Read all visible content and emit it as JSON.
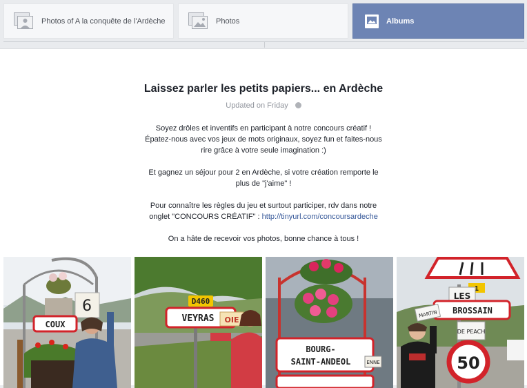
{
  "tabs": [
    {
      "label": "Photos of A la conquête de l'Ardèche",
      "icon": "photos-of-icon",
      "active": false
    },
    {
      "label": "Photos",
      "icon": "photos-icon",
      "active": false
    },
    {
      "label": "Albums",
      "icon": "albums-icon",
      "active": true
    }
  ],
  "album": {
    "title": "Laissez parler les petits papiers... en Ardèche",
    "updated": "Updated on Friday",
    "updated_icon": "globe-icon",
    "description": {
      "p1_line1": "Soyez drôles et inventifs en participant à notre concours créatif !",
      "p1_line2": "Épatez-nous avec vos jeux de mots originaux, soyez fun et faites-nous",
      "p1_line3": "rire grâce à votre seule imagination :)",
      "p2_line1": "Et gagnez un séjour pour 2 en Ardèche, si votre création remporte le",
      "p2_line2": "plus de \"j'aime\" !",
      "p3_line1": "Pour connaître les règles du jeu et surtout participer, rdv dans notre",
      "p3_line2_prefix": "onglet \"CONCOURS CRÉATIF\" : ",
      "p3_link": "http://tinyurl.com/concoursardeche",
      "p4": "On a hâte de recevoir vos photos, bonne chance à tous !"
    }
  },
  "photos": [
    {
      "sign_text": "COUX",
      "card_text": "6"
    },
    {
      "sign_text": "VEYRAS",
      "road_number": "D460",
      "card_text": "OIE"
    },
    {
      "sign_text_line1": "BOURG-",
      "sign_text_line2": "SAINT-ANDEOL",
      "card_text": "ENNE"
    },
    {
      "sign_text": "BROSSAIN",
      "card_top": "LES",
      "card_left": "MARTIN",
      "card_right": "DE PEACH",
      "road_number": "1",
      "speed": "50"
    }
  ],
  "colors": {
    "active_tab": "#6d84b4",
    "link": "#365899",
    "sign_red": "#d2232a"
  }
}
